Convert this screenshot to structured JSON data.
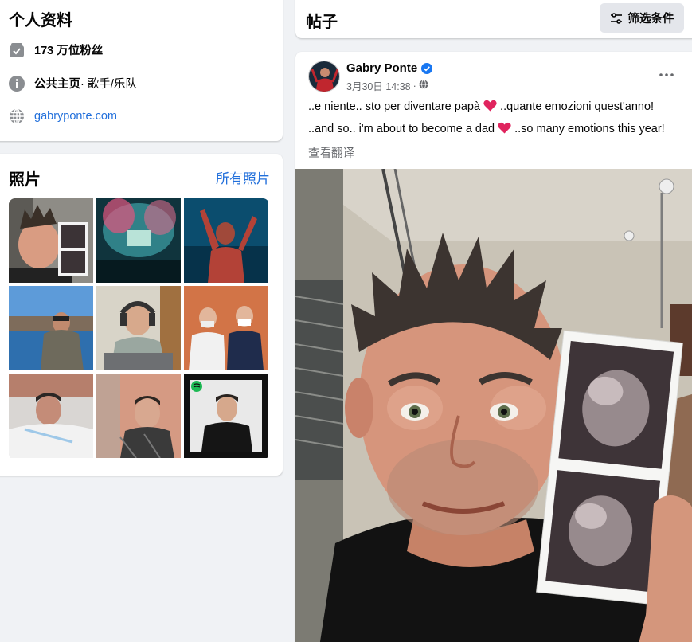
{
  "intro": {
    "title": "个人资料",
    "followers_count": "173 万位粉丝",
    "page_type_label": "公共主页",
    "page_category": " · 歌手/乐队",
    "website": "gabryponte.com",
    "icons": [
      "followers-icon",
      "info-icon",
      "globe-icon"
    ]
  },
  "photos": {
    "title": "照片",
    "see_all": "所有照片",
    "items": [
      "photo-ultrasound-selfie",
      "photo-concert-crowd",
      "photo-dj-performance",
      "photo-lakeside",
      "photo-headphones",
      "photo-doctors",
      "photo-hospital-bed",
      "photo-hospital-selfie",
      "photo-spotify-portrait"
    ]
  },
  "posts": {
    "title": "帖子",
    "filter_label": "筛选条件"
  },
  "post": {
    "author": "Gabry Ponte",
    "date": "3月30日 14:38",
    "dot": "·",
    "line1_a": "..e niente.. sto per diventare papà",
    "line1_b": "..quante emozioni quest'anno!",
    "line2_a": "..and so.. i'm about to become a dad",
    "line2_b": "..so many emotions this year!",
    "see_translation": "查看翻译"
  },
  "colors": {
    "link": "#216fdb",
    "verified": "#1877f2",
    "heart": "#e0245e",
    "background": "#f0f2f5"
  }
}
